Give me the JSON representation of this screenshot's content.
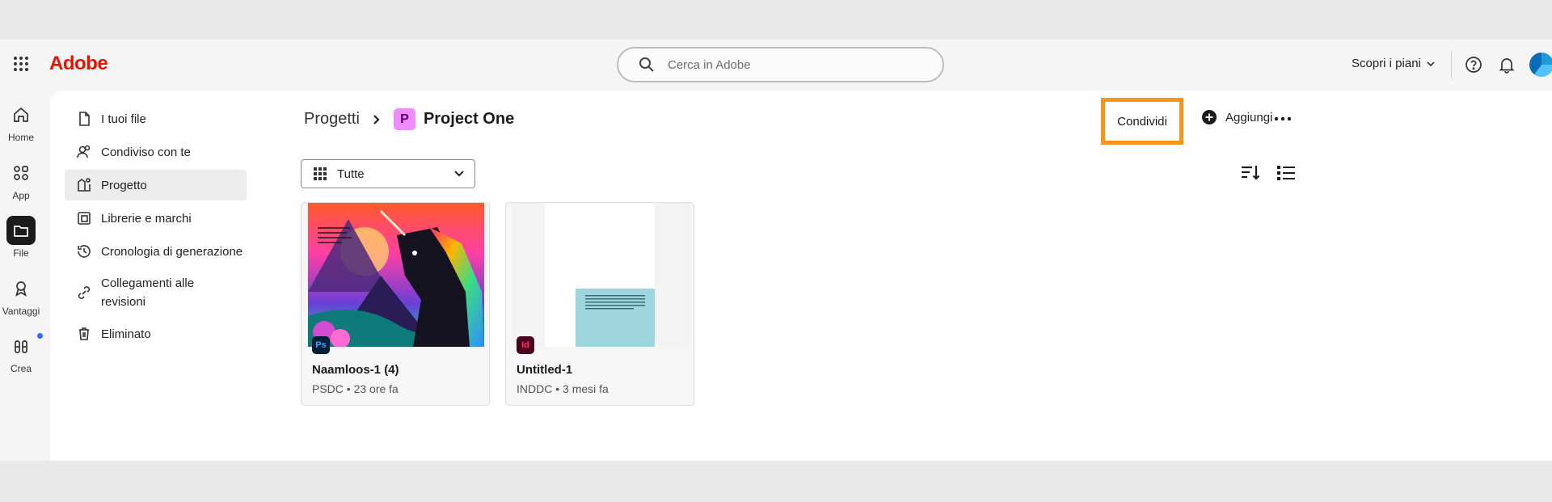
{
  "topbar": {
    "logo": "Adobe",
    "search_placeholder": "Cerca in Adobe",
    "plans_label": "Scopri i piani"
  },
  "rail": {
    "items": [
      {
        "label": "Home",
        "icon": "home-icon"
      },
      {
        "label": "App",
        "icon": "apps-icon"
      },
      {
        "label": "File",
        "icon": "folder-icon",
        "active": true
      },
      {
        "label": "Vantaggi",
        "icon": "award-icon"
      },
      {
        "label": "Crea",
        "icon": "create-icon"
      }
    ]
  },
  "subnav": {
    "items": [
      {
        "label": "I tuoi file",
        "icon": "file-icon"
      },
      {
        "label": "Condiviso con te",
        "icon": "people-icon"
      },
      {
        "label": "Progetto",
        "icon": "project-icon",
        "active": true
      },
      {
        "label": "Librerie e marchi",
        "icon": "library-icon"
      },
      {
        "label": "Cronologia di generazione",
        "icon": "history-icon"
      },
      {
        "label": "Collegamenti alle revisioni",
        "icon": "link-icon"
      },
      {
        "label": "Eliminato",
        "icon": "trash-icon"
      }
    ]
  },
  "header": {
    "breadcrumb_parent": "Progetti",
    "project_badge": "P",
    "project_name": "Project One",
    "share_label": "Condividi",
    "add_label": "Aggiungi"
  },
  "filter": {
    "selected": "Tutte"
  },
  "files": [
    {
      "name": "Naamloos-1 (4)",
      "meta": "PSDC • 23 ore fa",
      "app": "Ps",
      "app_color": "#001e36",
      "app_text_color": "#31a8ff"
    },
    {
      "name": "Untitled-1",
      "meta": "INDDC • 3 mesi fa",
      "app": "Id",
      "app_color": "#49021f",
      "app_text_color": "#ff3366"
    }
  ],
  "colors": {
    "adobe_red": "#eb1000",
    "share_highlight": "#f7941d",
    "project_badge": "#ef8bff"
  }
}
